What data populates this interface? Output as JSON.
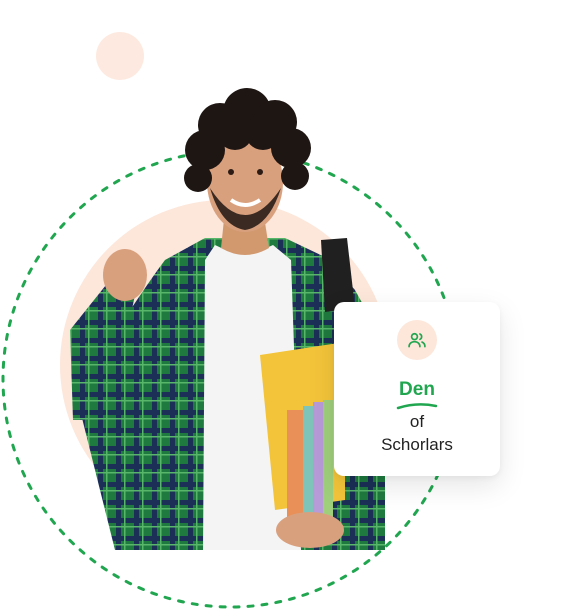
{
  "colors": {
    "accent_green": "#21a650",
    "peach": "#fde9df",
    "card_bg": "#ffffff",
    "text_dark": "#222222"
  },
  "card": {
    "icon": "users-icon",
    "title": "Den",
    "line1": "of",
    "line2": "Schorlars"
  }
}
